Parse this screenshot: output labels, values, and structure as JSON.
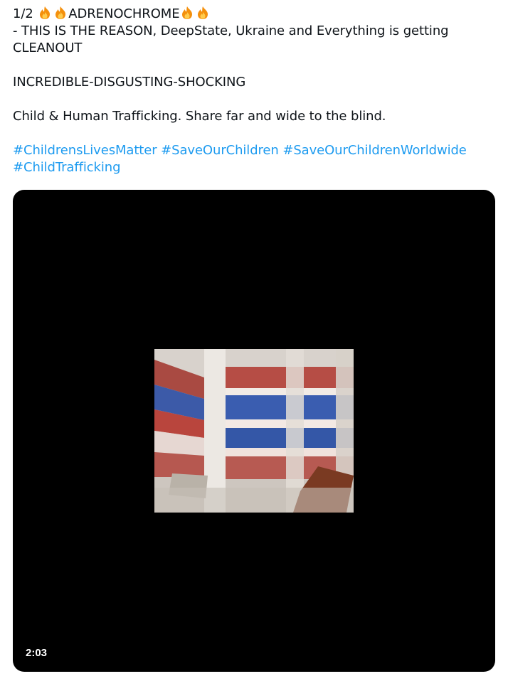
{
  "tweet": {
    "line1_prefix": "1/2 ",
    "line1_title": "ADRENOCHROME",
    "line2": "- THIS IS THE REASON, DeepState, Ukraine and Everything is getting",
    "line3": "CLEANOUT",
    "line4": "INCREDIBLE-DISGUSTING-SHOCKING",
    "line5": "Child & Human Trafficking. Share far and wide to the blind.",
    "hashtags": [
      "#ChildrensLivesMatter",
      "#SaveOurChildren",
      "#SaveOurChildrenWorldwide",
      "#ChildTrafficking"
    ],
    "emoji_icon": "fire-emoji"
  },
  "video": {
    "duration": "2:03",
    "background_color": "#000000"
  },
  "colors": {
    "text": "#0f1419",
    "link": "#1d9bf0"
  }
}
